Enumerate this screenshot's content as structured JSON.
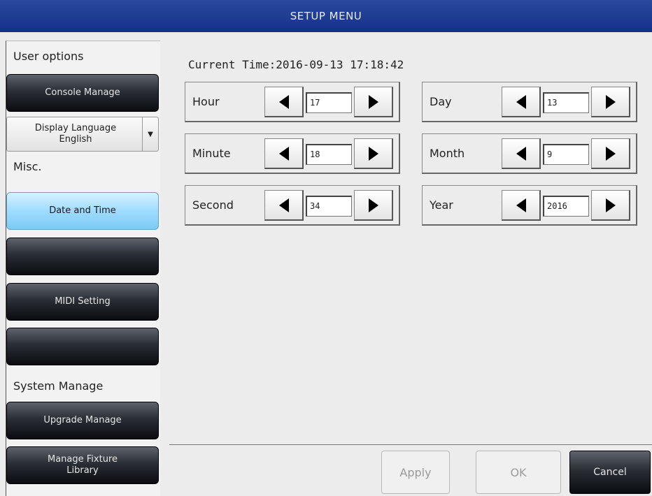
{
  "window": {
    "title": "SETUP MENU"
  },
  "sidebar": {
    "user_options_label": "User options",
    "console_manage": "Console Manage",
    "display_language": {
      "title": "Display Language",
      "value": "English"
    },
    "misc_label": "Misc.",
    "date_and_time": "Date and Time",
    "blank_button_1": "",
    "midi_setting": "MIDI Setting",
    "blank_button_2": "",
    "system_manage_label": "System Manage",
    "upgrade_manage": "Upgrade Manage",
    "manage_fixture_library": {
      "line1": "Manage Fixture",
      "line2": "Library"
    }
  },
  "main": {
    "current_time": "Current Time:2016-09-13 17:18:42",
    "fields": {
      "hour": {
        "label": "Hour",
        "value": "17"
      },
      "minute": {
        "label": "Minute",
        "value": "18"
      },
      "second": {
        "label": "Second",
        "value": "34"
      },
      "day": {
        "label": "Day",
        "value": "13"
      },
      "month": {
        "label": "Month",
        "value": "9"
      },
      "year": {
        "label": "Year",
        "value": "2016"
      }
    }
  },
  "footer": {
    "apply": "Apply",
    "ok": "OK",
    "cancel": "Cancel"
  },
  "icons": {
    "decrement": "left-triangle-icon",
    "increment": "right-triangle-icon",
    "dropdown": "caret-down-icon"
  },
  "colors": {
    "titlebar": "#1f3c96",
    "active_button": "#9fdcff",
    "dark_button": "#1a1d23"
  }
}
